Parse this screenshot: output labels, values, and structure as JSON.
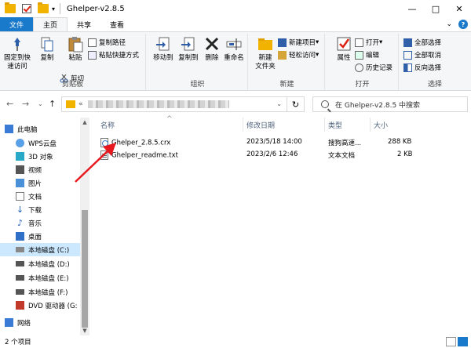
{
  "window": {
    "title": "Ghelper-v2.8.5",
    "minimize": "—",
    "maximize": "□",
    "close": "✕"
  },
  "tabs": [
    {
      "label": "文件"
    },
    {
      "label": "主页"
    },
    {
      "label": "共享"
    },
    {
      "label": "查看"
    }
  ],
  "ribbon": {
    "pin_label": "固定到快\n速访问",
    "copy_label": "复制",
    "paste_label": "粘贴",
    "copy_path": "复制路径",
    "paste_shortcut": "粘贴快捷方式",
    "cut": "剪切",
    "clipboard_group": "剪贴板",
    "move_to": "移动到",
    "copy_to": "复制到",
    "delete": "删除",
    "rename": "重命名",
    "organize_group": "组织",
    "new_folder": "新建\n文件夹",
    "new_item": "新建项目",
    "easy_access": "轻松访问",
    "new_group": "新建",
    "properties": "属性",
    "open": "打开",
    "edit": "编辑",
    "history": "历史记录",
    "open_group": "打开",
    "select_all": "全部选择",
    "select_none": "全部取消",
    "invert": "反向选择",
    "select_group": "选择"
  },
  "address": {
    "prefix": "«",
    "search_placeholder": "在 Ghelper-v2.8.5 中搜索"
  },
  "nav": {
    "items": [
      {
        "label": "此电脑"
      },
      {
        "label": "WPS云盘"
      },
      {
        "label": "3D 对象"
      },
      {
        "label": "视频"
      },
      {
        "label": "图片"
      },
      {
        "label": "文档"
      },
      {
        "label": "下载"
      },
      {
        "label": "音乐"
      },
      {
        "label": "桌面"
      },
      {
        "label": "本地磁盘 (C:)"
      },
      {
        "label": "本地磁盘 (D:)"
      },
      {
        "label": "本地磁盘 (E:)"
      },
      {
        "label": "本地磁盘 (F:)"
      },
      {
        "label": "DVD 驱动器 (G:"
      },
      {
        "label": "网络"
      }
    ]
  },
  "columns": {
    "name": "名称",
    "modified": "修改日期",
    "type": "类型",
    "size": "大小"
  },
  "files": [
    {
      "name": "Ghelper_2.8.5.crx",
      "modified": "2023/5/18 14:00",
      "type": "搜狗高速...",
      "size": "288 KB"
    },
    {
      "name": "Ghelper_readme.txt",
      "modified": "2023/2/6 12:46",
      "type": "文本文档",
      "size": "2 KB"
    }
  ],
  "status": {
    "count": "2 个项目"
  },
  "colors": {
    "accent": "#1979ca",
    "annotation_arrow": "#e8181f",
    "folder": "#f2b300"
  }
}
